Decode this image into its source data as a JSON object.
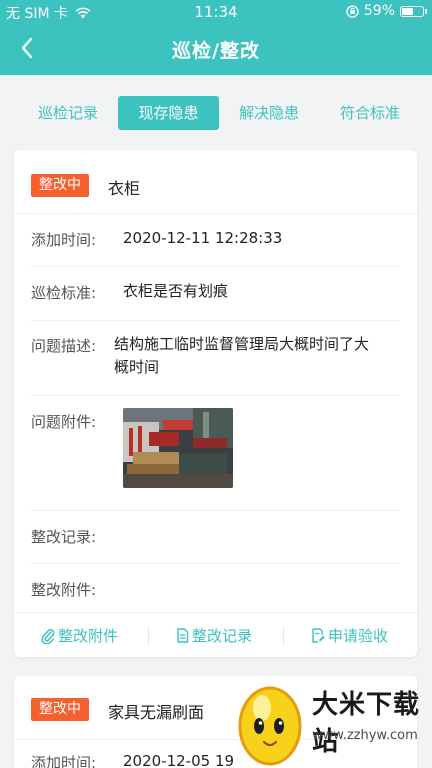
{
  "status_bar": {
    "carrier": "无 SIM 卡",
    "time": "11:34",
    "battery": "59%",
    "battery_level": 0.59
  },
  "header": {
    "title": "巡检/整改"
  },
  "tabs": [
    {
      "label": "巡检记录",
      "active": false
    },
    {
      "label": "现存隐患",
      "active": true
    },
    {
      "label": "解决隐患",
      "active": false
    },
    {
      "label": "符合标准",
      "active": false
    }
  ],
  "cards": [
    {
      "status": "整改中",
      "name": "衣柜",
      "add_time_label": "添加时间:",
      "add_time": "2020-12-11 12:28:33",
      "standard_label": "巡检标准:",
      "standard": "衣柜是否有划痕",
      "desc_label": "问题描述:",
      "desc_line1": "结构施工临时监督管理局大概时间了大",
      "desc_line2": "概时间",
      "attach_label": "问题附件:",
      "rectify_record_label": "整改记录:",
      "rectify_attach_label": "整改附件:",
      "actions": [
        "整改附件",
        "整改记录",
        "申请验收"
      ]
    },
    {
      "status": "整改中",
      "name": "家具无漏刷面",
      "add_time_label": "添加时间:",
      "add_time": "2020-12-05 19"
    }
  ],
  "watermark": {
    "name": "大米下载站",
    "url": "www.zzhyw.com"
  },
  "colors": {
    "primary": "#3cc3bf",
    "badge": "#f4612f",
    "background": "#f2f3f5"
  }
}
